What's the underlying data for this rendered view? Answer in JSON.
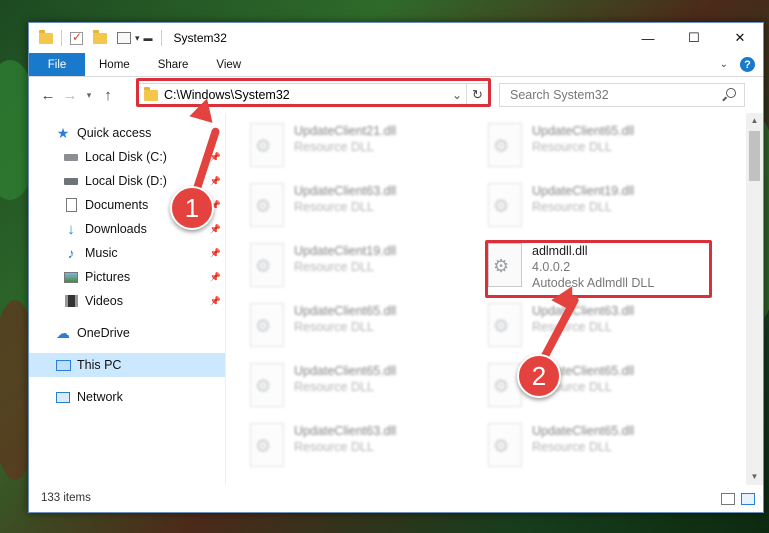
{
  "window": {
    "title": "System32"
  },
  "controls": {
    "minimize": "—",
    "maximize": "☐",
    "close": "✕"
  },
  "ribbon": {
    "tabs": [
      "File",
      "Home",
      "Share",
      "View"
    ]
  },
  "address": {
    "path": "C:\\Windows\\System32"
  },
  "search": {
    "placeholder": "Search System32"
  },
  "sidebar": {
    "items": [
      {
        "label": "Quick access",
        "icon": "star-icon"
      },
      {
        "label": "Local Disk (C:)",
        "icon": "drive-icon",
        "pinned": true
      },
      {
        "label": "Local Disk (D:)",
        "icon": "drive-icon",
        "pinned": true
      },
      {
        "label": "Documents",
        "icon": "documents-icon",
        "pinned": true
      },
      {
        "label": "Downloads",
        "icon": "download-icon",
        "pinned": true
      },
      {
        "label": "Music",
        "icon": "music-icon",
        "pinned": true
      },
      {
        "label": "Pictures",
        "icon": "pictures-icon",
        "pinned": true
      },
      {
        "label": "Videos",
        "icon": "videos-icon",
        "pinned": true
      },
      {
        "label": "OneDrive",
        "icon": "cloud-icon"
      },
      {
        "label": "This PC",
        "icon": "computer-icon",
        "selected": true
      },
      {
        "label": "Network",
        "icon": "network-icon"
      }
    ]
  },
  "files": [
    {
      "name": "UpdateClient21.dll",
      "desc": "Resource DLL"
    },
    {
      "name": "UpdateClient65.dll",
      "desc": "Resource DLL"
    },
    {
      "name": "UpdateClient63.dll",
      "desc": "Resource DLL"
    },
    {
      "name": "UpdateClient19.dll",
      "desc": "Resource DLL"
    },
    {
      "name": "UpdateClient19.dll",
      "desc": "Resource DLL"
    },
    {
      "name": "adlmdll.dll",
      "version": "4.0.0.2",
      "desc": "Autodesk Adlmdll DLL"
    },
    {
      "name": "UpdateClient65.dll",
      "desc": "Resource DLL"
    },
    {
      "name": "UpdateClient63.dll",
      "desc": "Resource DLL"
    },
    {
      "name": "UpdateClient65.dll",
      "desc": "Resource DLL"
    },
    {
      "name": "UpdateClient65.dll",
      "desc": "Resource DLL"
    },
    {
      "name": "UpdateClient63.dll",
      "desc": "Resource DLL"
    },
    {
      "name": "UpdateClient65.dll",
      "desc": "Resource DLL"
    }
  ],
  "status": {
    "count": "133 items"
  },
  "annotations": {
    "step1": "1",
    "step2": "2",
    "color": "#e3423e",
    "box_color": "#d9303a"
  }
}
